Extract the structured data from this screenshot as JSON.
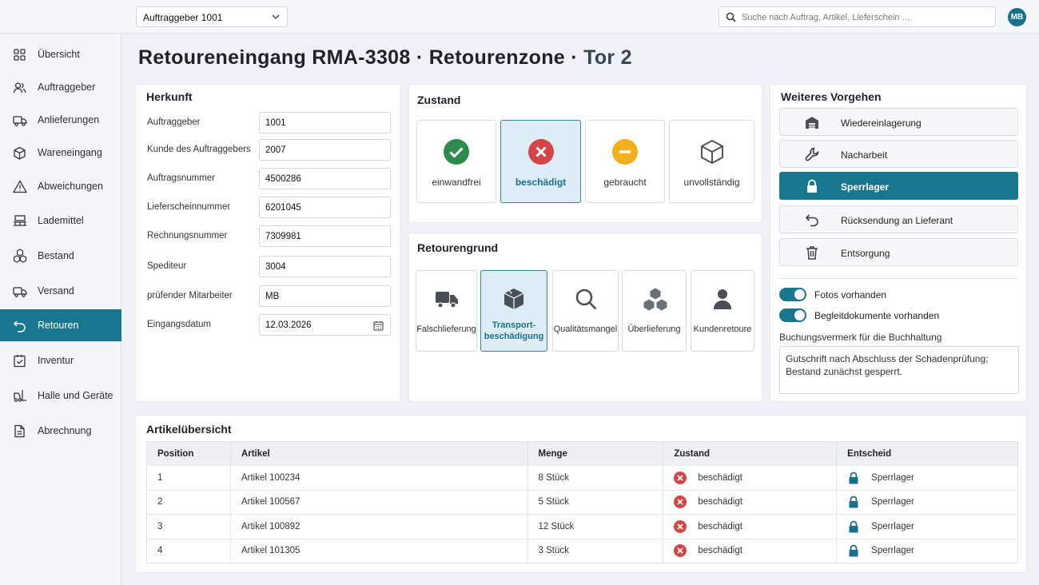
{
  "topbar": {
    "client_select": "Auftraggeber 1001",
    "search_placeholder": "Suche nach Auftrag, Artikel, Lieferschein …",
    "avatar_initials": "MB"
  },
  "sidebar": {
    "items": [
      {
        "label": "Übersicht",
        "icon": "grid-icon"
      },
      {
        "label": "Auftraggeber",
        "icon": "users-icon"
      },
      {
        "label": "Anlieferungen",
        "icon": "truck-icon"
      },
      {
        "label": "Wareneingang",
        "icon": "box-icon"
      },
      {
        "label": "Abweichungen",
        "icon": "warning-icon"
      },
      {
        "label": "Lademittel",
        "icon": "pallet-icon"
      },
      {
        "label": "Bestand",
        "icon": "stock-icon"
      },
      {
        "label": "Versand",
        "icon": "shipping-icon"
      },
      {
        "label": "Retouren",
        "icon": "return-icon",
        "active": true
      },
      {
        "label": "Inventur",
        "icon": "checklist-icon"
      },
      {
        "label": "Halle und Geräte",
        "icon": "forklift-icon"
      },
      {
        "label": "Abrechnung",
        "icon": "document-icon"
      }
    ]
  },
  "page": {
    "title_main": "Retoureneingang RMA-3308 · Retourenzone ·",
    "title_muted": "Tor 2"
  },
  "herkunft": {
    "heading": "Herkunft",
    "fields": [
      {
        "label": "Auftraggeber",
        "value": "1001"
      },
      {
        "label": "Kunde des Auftraggebers",
        "value": "2007"
      },
      {
        "label": "Auftragsnummer",
        "value": "4500286"
      },
      {
        "label": "Lieferscheinnummer",
        "value": "6201045"
      },
      {
        "label": "Rechnungsnummer",
        "value": "7309981"
      },
      {
        "label": "Spediteur",
        "value": "3004"
      },
      {
        "label": "prüfender Mitarbeiter",
        "value": "MB"
      },
      {
        "label": "Eingangsdatum",
        "value": "12.03.2026"
      }
    ]
  },
  "zustand": {
    "heading": "Zustand",
    "options": [
      {
        "label": "einwandfrei",
        "icon": "check-circle-icon",
        "color": "#2e8b4e"
      },
      {
        "label": "beschädigt",
        "icon": "x-circle-icon",
        "color": "#d64545",
        "selected": true
      },
      {
        "label": "gebraucht",
        "icon": "minus-circle-icon",
        "color": "#f2b01e"
      },
      {
        "label": "unvollständig",
        "icon": "box-icon",
        "color": "#555555"
      }
    ]
  },
  "retourengrund": {
    "heading": "Retourengrund",
    "options": [
      {
        "label": "Falschlieferung",
        "icon": "truck-icon"
      },
      {
        "label": "Transport-\nbeschädigung",
        "icon": "damaged-box-icon",
        "selected": true
      },
      {
        "label": "Qualitätsmangel",
        "icon": "magnifier-icon"
      },
      {
        "label": "Überlieferung",
        "icon": "boxes-icon"
      },
      {
        "label": "Kundenretoure",
        "icon": "person-icon"
      }
    ]
  },
  "vorgehen": {
    "heading": "Weiteres Vorgehen",
    "actions": [
      {
        "label": "Wiedereinlagerung",
        "icon": "warehouse-icon"
      },
      {
        "label": "Nacharbeit",
        "icon": "wrench-icon"
      },
      {
        "label": "Sperrlager",
        "icon": "lock-icon",
        "selected": true
      },
      {
        "label": "Rücksendung an Lieferant",
        "icon": "return-arrow-icon"
      },
      {
        "label": "Entsorgung",
        "icon": "trash-icon"
      }
    ],
    "toggles": [
      {
        "label": "Fotos vorhanden",
        "on": true
      },
      {
        "label": "Begleitdokumente vorhanden",
        "on": true
      }
    ],
    "note_label": "Buchungsvermerk für die Buchhaltung",
    "note_text": "Gutschrift nach Abschluss der Schadenprüfung; Bestand zunächst gesperrt."
  },
  "artikel": {
    "heading": "Artikelübersicht",
    "columns": [
      "Position",
      "Artikel",
      "Menge",
      "Zustand",
      "Entscheid"
    ],
    "rows": [
      {
        "position": "1",
        "artikel": "Artikel 100234",
        "menge": "8 Stück",
        "zustand": "beschädigt",
        "entscheid": "Sperrlager"
      },
      {
        "position": "2",
        "artikel": "Artikel 100567",
        "menge": "5 Stück",
        "zustand": "beschädigt",
        "entscheid": "Sperrlager"
      },
      {
        "position": "3",
        "artikel": "Artikel 100892",
        "menge": "12 Stück",
        "zustand": "beschädigt",
        "entscheid": "Sperrlager"
      },
      {
        "position": "4",
        "artikel": "Artikel 101305",
        "menge": "3 Stück",
        "zustand": "beschädigt",
        "entscheid": "Sperrlager"
      }
    ]
  },
  "colors": {
    "accent": "#19768f",
    "danger": "#d64545",
    "success": "#2e8b4e",
    "warning": "#f2b01e"
  }
}
